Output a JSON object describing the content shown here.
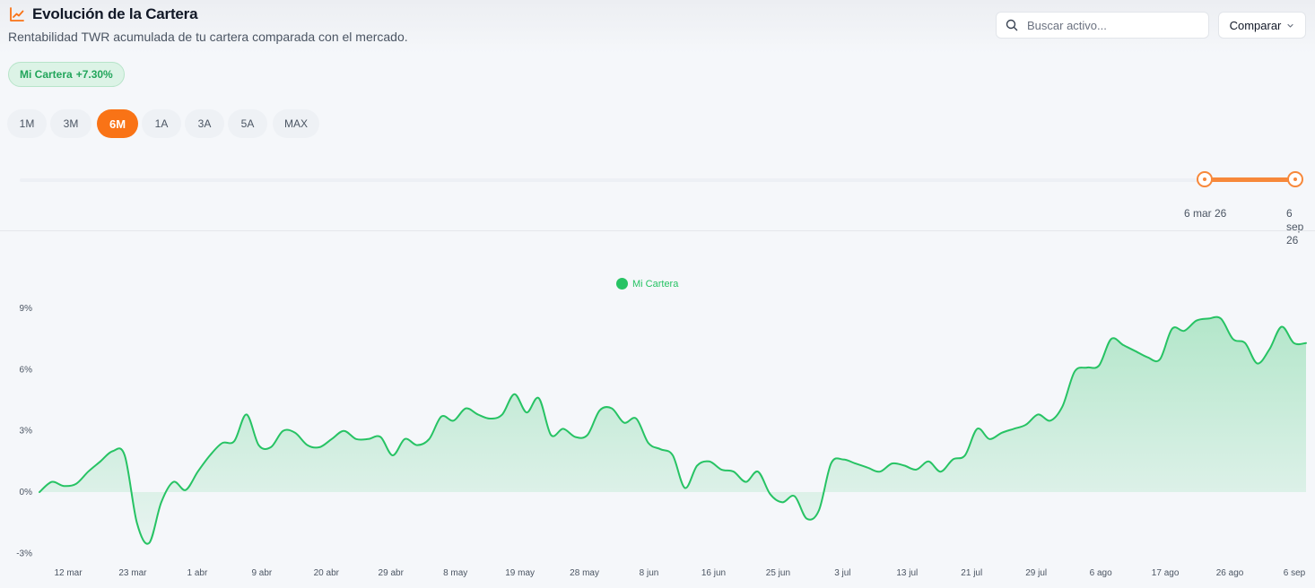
{
  "header": {
    "title": "Evolución de la Cartera",
    "subtitle": "Rentabilidad TWR acumulada de tu cartera comparada con el mercado.",
    "icon": "chart-line-icon"
  },
  "search": {
    "placeholder": "Buscar activo...",
    "icon": "search-icon"
  },
  "compare": {
    "label": "Comparar",
    "icon": "chevron-down-icon"
  },
  "badge": {
    "name": "Mi Cartera",
    "value": "+7.30%"
  },
  "ranges": {
    "items": [
      "1M",
      "3M",
      "6M",
      "1A",
      "3A",
      "5A",
      "MAX"
    ],
    "active": "6M"
  },
  "slider": {
    "start_label": "6 mar 26",
    "end_label_lines": [
      "6",
      "sep",
      "26"
    ]
  },
  "colors": {
    "accent": "#f97316",
    "series": "#27c364",
    "badge_bg": "#dcf3e6"
  },
  "chart_data": {
    "type": "area",
    "legend": [
      {
        "name": "Mi Cartera",
        "color": "#27c364"
      }
    ],
    "y_ticks": [
      "9%",
      "6%",
      "3%",
      "0%",
      "-3%"
    ],
    "ylim": [
      -3,
      9
    ],
    "x_ticks": [
      "12 mar",
      "23 mar",
      "1 abr",
      "9 abr",
      "20 abr",
      "29 abr",
      "8 may",
      "19 may",
      "28 may",
      "8 jun",
      "16 jun",
      "25 jun",
      "3 jul",
      "13 jul",
      "21 jul",
      "29 jul",
      "6 ago",
      "17 ago",
      "26 ago",
      "6 sep"
    ],
    "series": [
      {
        "name": "Mi Cartera",
        "values": [
          0.0,
          0.5,
          0.3,
          0.4,
          1.0,
          1.5,
          2.0,
          1.8,
          -1.5,
          -2.5,
          -0.5,
          0.5,
          0.1,
          1.0,
          1.8,
          2.4,
          2.5,
          3.8,
          2.3,
          2.2,
          3.0,
          2.9,
          2.3,
          2.2,
          2.6,
          3.0,
          2.6,
          2.6,
          2.7,
          1.8,
          2.6,
          2.3,
          2.6,
          3.7,
          3.5,
          4.1,
          3.8,
          3.6,
          3.8,
          4.8,
          3.9,
          4.6,
          2.8,
          3.1,
          2.7,
          2.8,
          4.0,
          4.1,
          3.4,
          3.6,
          2.4,
          2.1,
          1.8,
          0.2,
          1.3,
          1.5,
          1.1,
          1.0,
          0.5,
          1.0,
          -0.1,
          -0.5,
          -0.2,
          -1.3,
          -0.9,
          1.4,
          1.6,
          1.4,
          1.2,
          1.0,
          1.4,
          1.3,
          1.1,
          1.5,
          1.0,
          1.6,
          1.8,
          3.1,
          2.6,
          2.9,
          3.1,
          3.3,
          3.8,
          3.5,
          4.2,
          5.9,
          6.1,
          6.2,
          7.5,
          7.2,
          6.9,
          6.6,
          6.5,
          8.0,
          7.9,
          8.4,
          8.5,
          8.5,
          7.5,
          7.3,
          6.3,
          7.0,
          8.1,
          7.3,
          7.3
        ]
      }
    ]
  }
}
